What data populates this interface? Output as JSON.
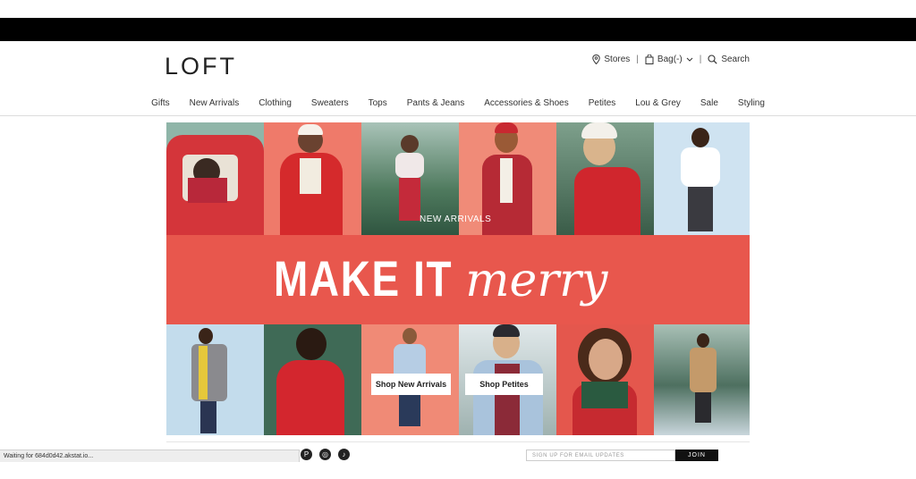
{
  "brand": {
    "logo": "LOFT"
  },
  "utility": {
    "stores": "Stores",
    "bag": "Bag(-)",
    "search": "Search"
  },
  "nav": [
    "Gifts",
    "New Arrivals",
    "Clothing",
    "Sweaters",
    "Tops",
    "Pants & Jeans",
    "Accessories & Shoes",
    "Petites",
    "Lou & Grey",
    "Sale",
    "Styling"
  ],
  "hero": {
    "overlay_label": "NEW ARRIVALS",
    "headline_bold": "MAKE IT",
    "headline_script": "merry",
    "cta_new_arrivals": "Shop New Arrivals",
    "cta_petites": "Shop Petites"
  },
  "footer": {
    "email_placeholder": "SIGN UP FOR EMAIL UPDATES",
    "join": "JOIN",
    "social_icons": [
      "pinterest-icon",
      "instagram-icon",
      "tiktok-icon"
    ]
  },
  "status": {
    "text": "Waiting for 684d0d42.akstat.io..."
  },
  "colors": {
    "banner": "#e8574d",
    "black_bar": "#000000",
    "accent_red": "#d93a3a"
  }
}
